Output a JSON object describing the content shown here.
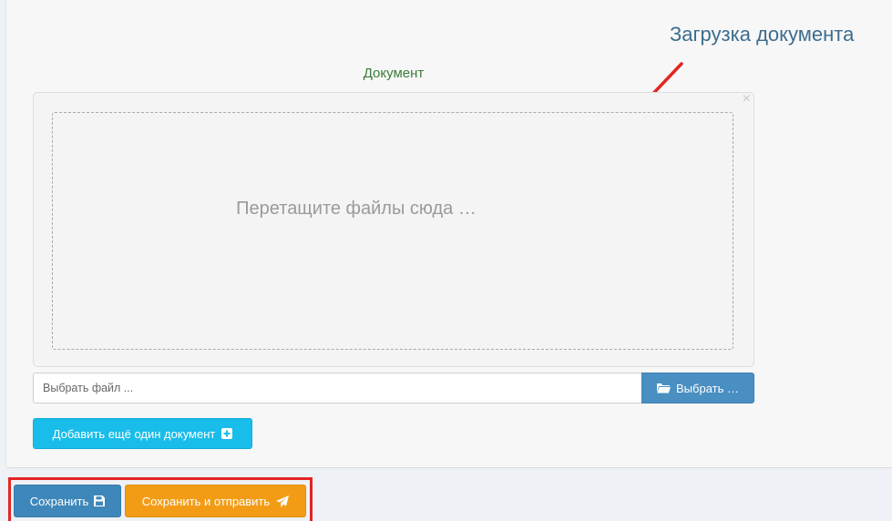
{
  "annotation": {
    "text": "Загрузка документа",
    "color": "#e32424"
  },
  "field": {
    "title": "Документ",
    "close_glyph": "×",
    "dropzone_text": "Перетащите файлы сюда …"
  },
  "file_input": {
    "placeholder": "Выбрать файл ...",
    "browse_label": "Выбрать …",
    "browse_icon": "folder-open-icon"
  },
  "add_document": {
    "label": "Добавить ещё один документ",
    "icon": "plus-square-icon"
  },
  "actions": {
    "save_label": "Сохранить",
    "save_icon": "floppy-disk-icon",
    "send_label": "Сохранить и отправить",
    "send_icon": "paper-plane-icon"
  },
  "colors": {
    "primary": "#3e87ba",
    "info": "#18bde9",
    "warning": "#f29c16",
    "title_green": "#3c7b3c",
    "highlight": "#e32424"
  }
}
